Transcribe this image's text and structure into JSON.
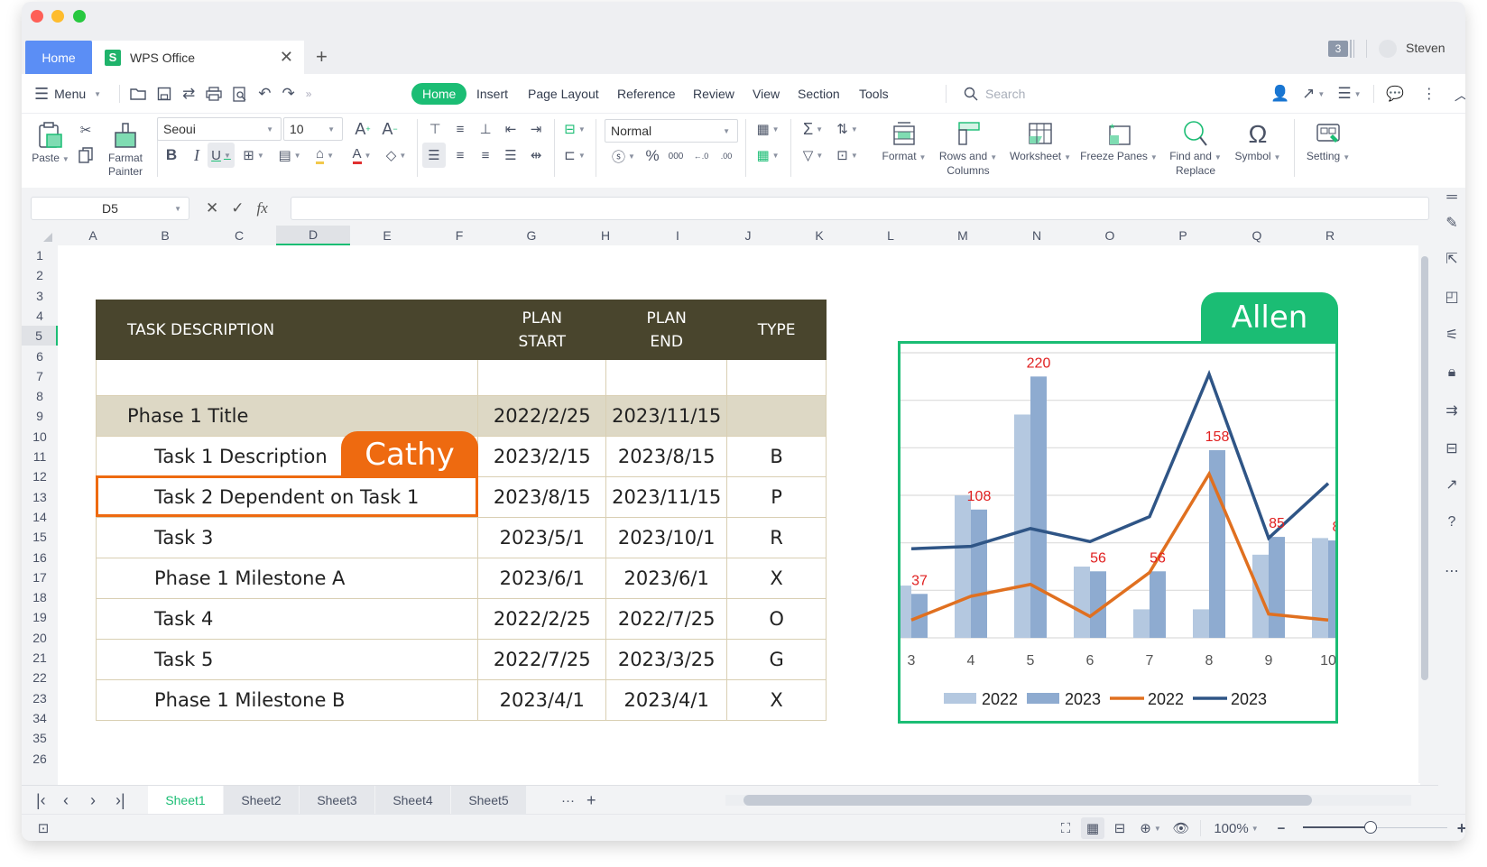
{
  "titlebar": {
    "home_tab": "Home",
    "doc_tab": "WPS Office",
    "doc_icon_letter": "S",
    "page_count": "3",
    "username": "Steven"
  },
  "menubar": {
    "menu_label": "Menu",
    "tabs": [
      "Home",
      "Insert",
      "Page Layout",
      "Reference",
      "Review",
      "View",
      "Section",
      "Tools"
    ],
    "active_tab": "Home",
    "search_placeholder": "Search"
  },
  "ribbon": {
    "paste": "Paste",
    "format_painter_1": "Farmat",
    "format_painter_2": "Painter",
    "font_name": "Seoui",
    "font_size": "10",
    "cell_style": "Normal",
    "format": "Format",
    "rows_cols_1": "Rows and",
    "rows_cols_2": "Columns",
    "worksheet": "Worksheet",
    "freeze": "Freeze Panes",
    "find_1": "Find and",
    "find_2": "Replace",
    "symbol": "Symbol",
    "setting": "Setting"
  },
  "formula_bar": {
    "cell_ref": "D5",
    "formula": ""
  },
  "grid": {
    "columns": [
      "A",
      "B",
      "C",
      "D",
      "E",
      "F",
      "G",
      "H",
      "I",
      "J",
      "K",
      "L",
      "M",
      "N",
      "O",
      "P",
      "Q",
      "R"
    ],
    "selected_column": "D",
    "rows": [
      "1",
      "2",
      "3",
      "4",
      "5",
      "6",
      "7",
      "8",
      "9",
      "10",
      "11",
      "12",
      "13",
      "14",
      "15",
      "16",
      "17",
      "18",
      "19",
      "20",
      "21",
      "22",
      "23",
      "34",
      "35",
      "26"
    ],
    "selected_row": "5"
  },
  "task_table": {
    "headers": {
      "desc": "TASK DESCRIPTION",
      "start_1": "PLAN",
      "start_2": "START",
      "end_1": "PLAN",
      "end_2": "END",
      "type": "TYPE"
    },
    "rows": [
      {
        "desc": "Phase 1 Title",
        "start": "2022/2/25",
        "end": "2023/11/15",
        "type": "",
        "phase": true
      },
      {
        "desc": "Task 1 Description",
        "start": "2023/2/15",
        "end": "2023/8/15",
        "type": "B"
      },
      {
        "desc": "Task 2 Dependent on Task 1",
        "start": "2023/8/15",
        "end": "2023/11/15",
        "type": "P"
      },
      {
        "desc": "Task 3",
        "start": "2023/5/1",
        "end": "2023/10/1",
        "type": "R"
      },
      {
        "desc": "Phase 1 Milestone A",
        "start": "2023/6/1",
        "end": "2023/6/1",
        "type": "X"
      },
      {
        "desc": "Task 4",
        "start": "2022/2/25",
        "end": "2022/7/25",
        "type": "O"
      },
      {
        "desc": "Task 5",
        "start": "2022/7/25",
        "end": "2023/3/25",
        "type": "G"
      },
      {
        "desc": "Phase 1 Milestone B",
        "start": "2023/4/1",
        "end": "2023/4/1",
        "type": "X"
      }
    ]
  },
  "collaborators": {
    "cathy": "Cathy",
    "allen": "Allen",
    "cathy_color": "#ee6a10",
    "allen_color": "#1bbd74"
  },
  "chart_data": {
    "type": "bar",
    "title": "",
    "categories": [
      "3",
      "4",
      "5",
      "6",
      "7",
      "8",
      "9",
      "10"
    ],
    "series": [
      {
        "name": "2022",
        "kind": "bar",
        "color": "#b4c8e0",
        "values": [
          44,
          120,
          188,
          60,
          24,
          24,
          70,
          84
        ]
      },
      {
        "name": "2023",
        "kind": "bar",
        "color": "#8eabd0",
        "values": [
          37,
          108,
          220,
          56,
          56,
          158,
          85,
          82
        ]
      },
      {
        "name": "2022",
        "kind": "line",
        "color": "#e07020",
        "values": [
          15,
          35,
          45,
          18,
          55,
          138,
          20,
          15
        ]
      },
      {
        "name": "2023",
        "kind": "line",
        "color": "#2f5586",
        "values": [
          75,
          77,
          92,
          81,
          102,
          222,
          84,
          130
        ]
      }
    ],
    "data_labels": [
      "37",
      "108",
      "220",
      "56",
      "56",
      "158",
      "85",
      "8"
    ],
    "ylim": [
      0,
      240
    ],
    "grid": true,
    "legend": "bottom",
    "label_color": "#e02020"
  },
  "sheets": {
    "tabs": [
      "Sheet1",
      "Sheet2",
      "Sheet3",
      "Sheet4",
      "Sheet5"
    ],
    "active": "Sheet1",
    "more": "···",
    "add": "+"
  },
  "statusbar": {
    "zoom": "100%",
    "zoom_fraction": 0.47
  }
}
